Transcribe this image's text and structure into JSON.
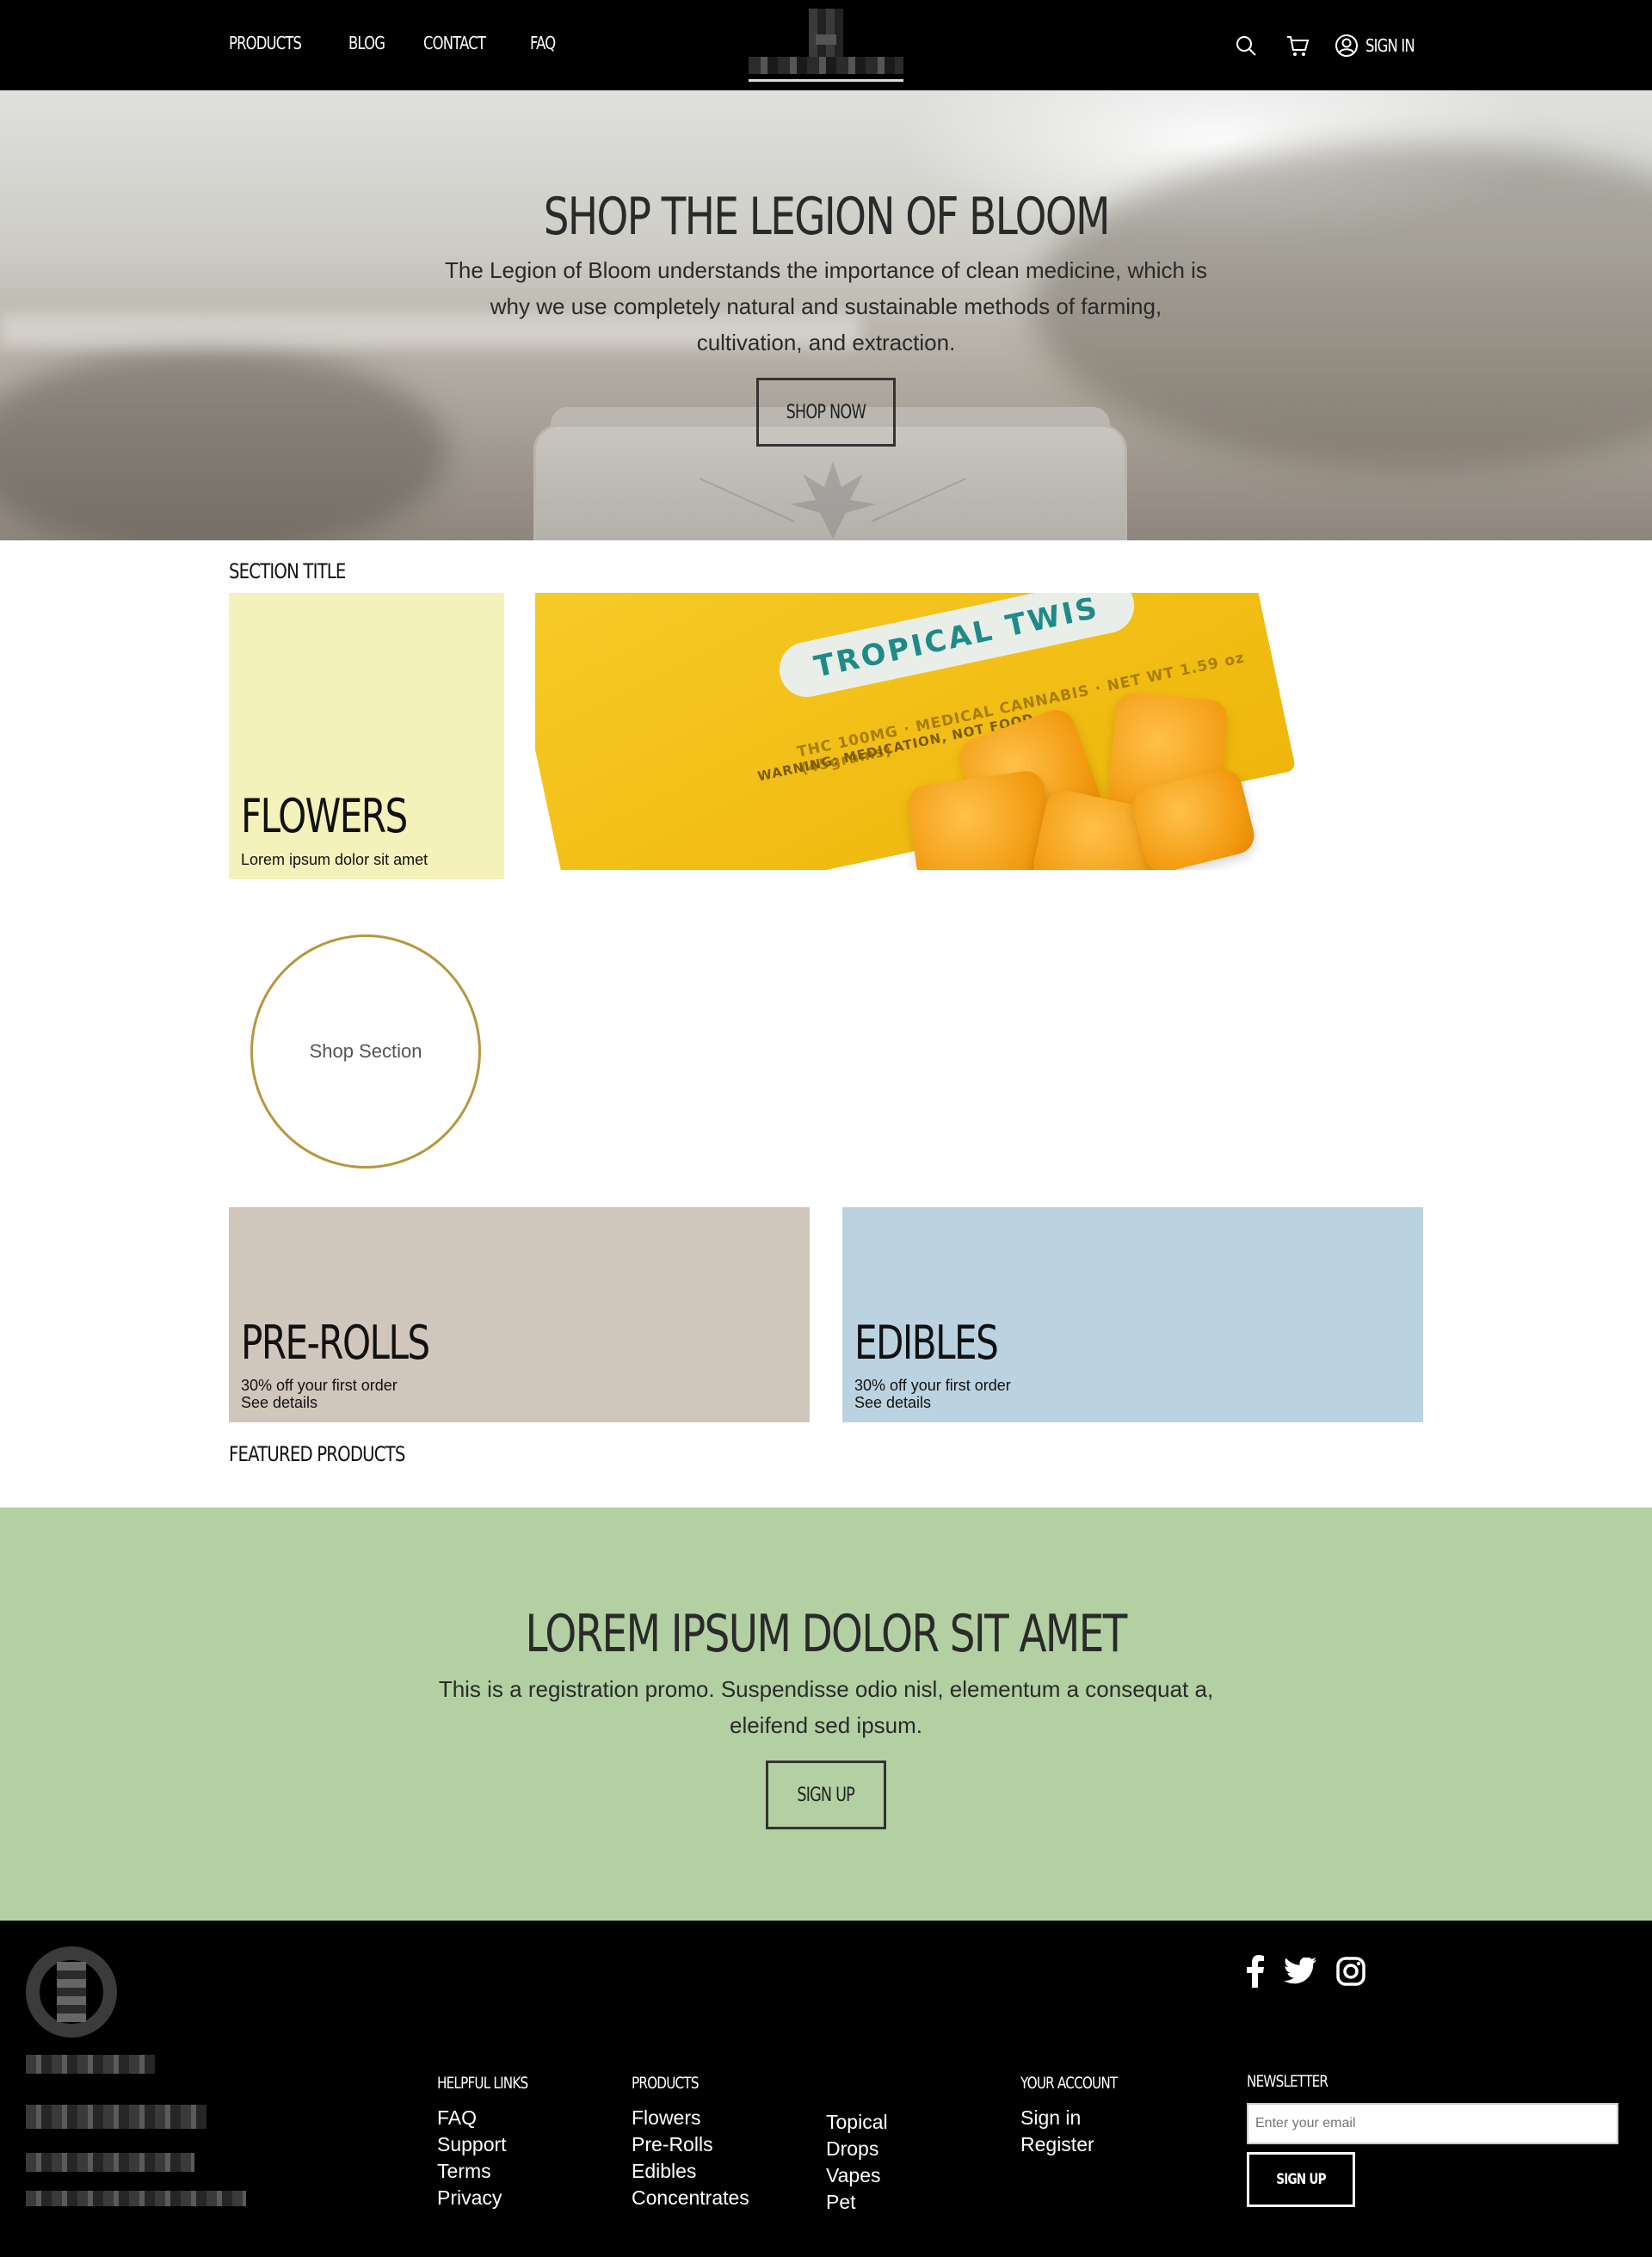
{
  "header": {
    "nav": [
      "PRODUCTS",
      "BLOG",
      "CONTACT",
      "FAQ"
    ],
    "signin_label": "SIGN IN"
  },
  "hero": {
    "title": "SHOP THE LEGION OF BLOOM",
    "description": "The Legion of Bloom understands the importance of clean medicine, which is why we use completely natural and sustainable methods of farming, cultivation, and extraction.",
    "button": "SHOP NOW"
  },
  "section": {
    "title": "SECTION TITLE",
    "flowers": {
      "title": "FLOWERS",
      "subtitle": "Lorem ipsum dolor sit amet"
    },
    "image": {
      "bag_label": "TROPICAL TWIS",
      "bag_line1": "THC 100MG · MEDICAL CANNABIS · NET WT 1.59 oz (45grams)",
      "bag_line2": "WARNING: MEDICATION, NOT FOOD."
    },
    "circle_label": "Shop Section",
    "prerolls": {
      "title": "PRE-ROLLS",
      "line1": "30% off your first order",
      "line2": "See details"
    },
    "edibles": {
      "title": "EDIBLES",
      "line1": "30% off your first order",
      "line2": "See details"
    },
    "featured_title": "FEATURED PRODUCTS"
  },
  "promo": {
    "title": "LOREM IPSUM DOLOR SIT AMET",
    "description": "This is a registration promo. Suspendisse odio nisl, elementum a consequat a, eleifend sed ipsum.",
    "button": "SIGN UP"
  },
  "footer": {
    "social": [
      "facebook-icon",
      "twitter-icon",
      "instagram-icon"
    ],
    "helpful": {
      "heading": "HELPFUL LINKS",
      "links": [
        "FAQ",
        "Support",
        "Terms",
        "Privacy"
      ]
    },
    "products": {
      "heading": "PRODUCTS",
      "col1": [
        "Flowers",
        "Pre-Rolls",
        "Edibles",
        "Concentrates"
      ],
      "col2": [
        "Topical",
        "Drops",
        "Vapes",
        "Pet"
      ]
    },
    "account": {
      "heading": "YOUR ACCOUNT",
      "links": [
        "Sign in",
        "Register"
      ]
    },
    "newsletter": {
      "heading": "NEWSLETTER",
      "placeholder": "Enter your email",
      "button": "SIGN UP"
    }
  },
  "colors": {
    "flowers_tile": "#f5f1bb",
    "prerolls_tile": "#d1c6bb",
    "edibles_tile": "#bbd3e1",
    "promo_bg": "#b2d0a2",
    "circle_border": "#b8963e"
  }
}
